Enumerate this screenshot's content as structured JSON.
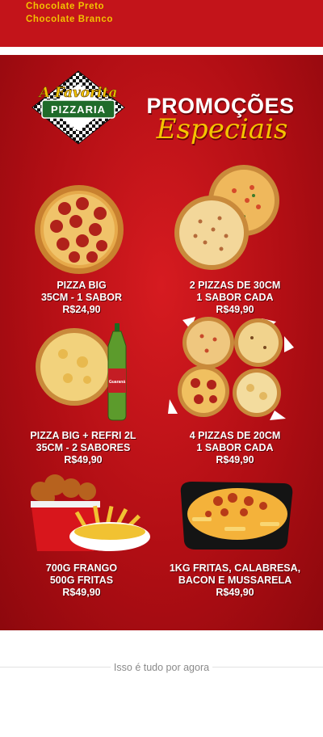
{
  "top_menu": {
    "items": [
      "Chocolate Preto",
      "Chocolate Branco"
    ]
  },
  "logo": {
    "line1": "A Favorita",
    "line2": "PIZZARIA"
  },
  "header": {
    "title": "PROMOÇÕES",
    "subtitle": "Especiais"
  },
  "promotions": [
    {
      "line1": "PIZZA BIG",
      "line2": "35CM - 1 SABOR",
      "price": "R$24,90"
    },
    {
      "line1": "2 PIZZAS DE 30CM",
      "line2": "1 SABOR CADA",
      "price": "R$49,90"
    },
    {
      "line1": "PIZZA BIG + REFRI 2L",
      "line2": "35CM - 2 SABORES",
      "price": "R$49,90"
    },
    {
      "line1": "4 PIZZAS DE 20CM",
      "line2": "1 SABOR CADA",
      "price": "R$49,90"
    },
    {
      "line1": "700G FRANGO",
      "line2": "500G FRITAS",
      "price": "R$49,90"
    },
    {
      "line1": "1KG FRITAS, CALABRESA,",
      "line2": "BACON E MUSSARELA",
      "price": "R$49,90"
    }
  ],
  "soda_label": "Guaraná",
  "footer": {
    "end_text": "Isso é tudo por agora"
  },
  "colors": {
    "poster_red": "#c3141a",
    "accent_yellow": "#f4c400",
    "logo_green": "#1f6b2a"
  }
}
